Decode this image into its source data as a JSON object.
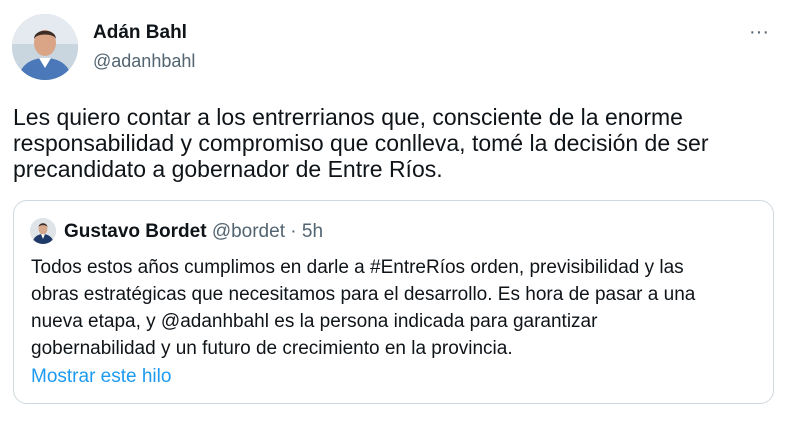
{
  "author": {
    "name": "Adán Bahl",
    "handle": "@adanhbahl"
  },
  "menu": {
    "icon": "more-horizontal-icon",
    "glyph": "···"
  },
  "tweet": {
    "lines": [
      "Les quiero contar a los entrerrianos que, consciente de la enorme",
      "responsabilidad y compromiso que conlleva, tomé la decisión de ser",
      "precandidato a gobernador de Entre Ríos."
    ]
  },
  "quoted": {
    "name": "Gustavo Bordet",
    "handle": "@bordet",
    "separator": "·",
    "time": "5h",
    "lines": [
      "Todos estos años cumplimos en darle a #EntreRíos orden, previsibilidad y las",
      "obras estratégicas que necesitamos para el desarrollo. Es hora de pasar a una",
      "nueva etapa, y @adanhbahl es la persona indicada para garantizar",
      "gobernabilidad y un futuro de crecimiento en la provincia."
    ],
    "show_thread": "Mostrar este hilo"
  },
  "colors": {
    "text": "#0f1419",
    "secondary": "#536471",
    "link": "#1d9bf0",
    "border": "#cfd9de"
  }
}
